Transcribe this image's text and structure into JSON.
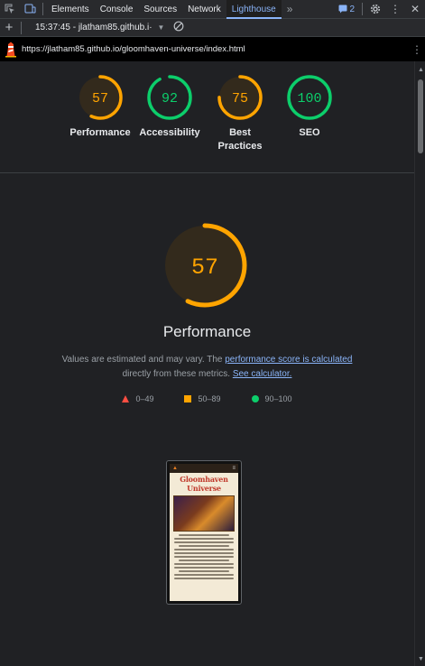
{
  "devtools": {
    "tabs": [
      "Elements",
      "Console",
      "Sources",
      "Network",
      "Lighthouse"
    ],
    "active_tab": "Lighthouse",
    "more_tabs": "»",
    "issues_count": "2"
  },
  "toolbar": {
    "report_label": "15:37:45 - jlatham85.github.i·"
  },
  "urlbar": {
    "url": "https://jlatham85.github.io/gloomhaven-universe/index.html"
  },
  "scores": [
    {
      "label": "Performance",
      "value": "57",
      "score": 57,
      "color": "#ffa400",
      "bg": "#332a1c"
    },
    {
      "label": "Accessibility",
      "value": "92",
      "score": 92,
      "color": "#0cce6b",
      "bg": "#202124"
    },
    {
      "label": "Best\nPractices",
      "value": "75",
      "score": 75,
      "color": "#ffa400",
      "bg": "#332a1c"
    },
    {
      "label": "SEO",
      "value": "100",
      "score": 100,
      "color": "#0cce6b",
      "bg": "#202124"
    }
  ],
  "performance": {
    "value": "57",
    "score": 57,
    "title": "Performance",
    "desc_pre": "Values are estimated and may vary. The ",
    "desc_link1": "performance score is calculated",
    "desc_mid": " directly from these metrics. ",
    "desc_link2": "See calculator."
  },
  "legend": [
    {
      "shape": "triangle",
      "label": "0–49",
      "color": "#ff4e42"
    },
    {
      "shape": "square",
      "label": "50–89",
      "color": "#ffa400"
    },
    {
      "shape": "circle",
      "label": "90–100",
      "color": "#0cce6b"
    }
  ],
  "thumbnail": {
    "site_title": "Gloomhaven Universe"
  }
}
